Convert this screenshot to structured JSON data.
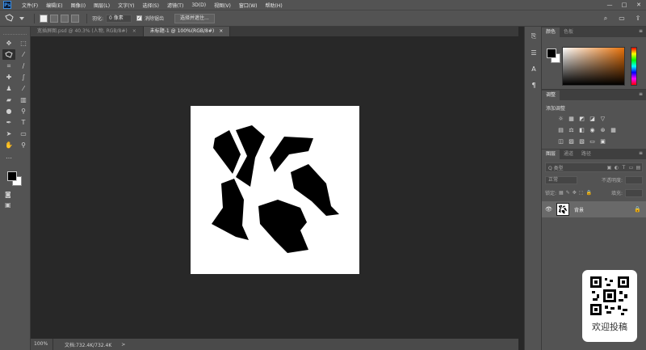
{
  "app": {
    "logo": "Ps"
  },
  "menubar": {
    "items": [
      "文件(F)",
      "编辑(E)",
      "图像(I)",
      "图层(L)",
      "文字(Y)",
      "选择(S)",
      "滤镜(T)",
      "3D(D)",
      "视图(V)",
      "窗口(W)",
      "帮助(H)"
    ],
    "window_controls": [
      "—",
      "□",
      "✕"
    ]
  },
  "options": {
    "feather_label": "羽化:",
    "feather_value": "0 像素",
    "antialias_label": "消除锯齿",
    "select_mask_button": "选择并遮住..."
  },
  "tabs": [
    {
      "label": "宽插屏图.psd @ 40.3% (人物, RGB/8#)",
      "close": "×"
    },
    {
      "label": "未标题-1 @ 100%(RGB/8#)",
      "close": "×"
    }
  ],
  "status": {
    "zoom": "100%",
    "doc_info": "文档:732.4K/732.4K",
    "arrow": ">"
  },
  "panels": {
    "color": {
      "tabs": [
        "颜色",
        "色板"
      ]
    },
    "adjustments": {
      "tab": "调整",
      "subtitle": "添加调整"
    },
    "layers": {
      "tabs": [
        "图层",
        "通道",
        "路径"
      ],
      "filter_label": "Q 类型",
      "blend_mode": "正常",
      "opacity_label": "不透明度:",
      "lock_label": "锁定:",
      "fill_label": "填充:",
      "layer_name": "背景"
    }
  },
  "promo": {
    "text": "欢迎投稿"
  },
  "colors": {
    "chrome": "#535353",
    "canvas_bg": "#282828",
    "accent": "#3a8ee6"
  }
}
